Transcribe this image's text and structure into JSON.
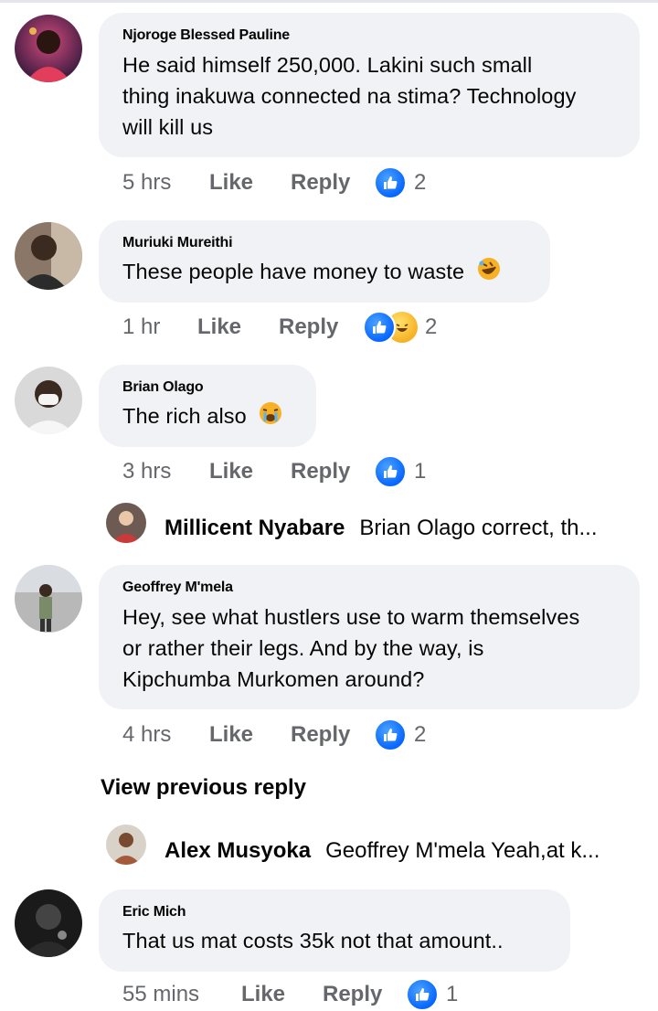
{
  "comments": [
    {
      "name": "Njoroge Blessed Pauline",
      "lines": [
        "He said himself 250,000. Lakini such small",
        "thing inakuwa connected na stima? Technology",
        "will kill us"
      ],
      "time": "5 hrs",
      "like": "Like",
      "reply": "Reply",
      "reaction_count": "2"
    },
    {
      "name": "Muriuki Mureithi",
      "lines": [
        "These people have money to waste"
      ],
      "emoji": "rolling-laughing-emoji",
      "time": "1 hr",
      "like": "Like",
      "reply": "Reply",
      "reaction_count": "2",
      "reactions": [
        "like-icon",
        "haha-icon"
      ]
    },
    {
      "name": "Brian Olago",
      "lines": [
        "The rich also"
      ],
      "emoji": "crying-face-emoji",
      "time": "3 hrs",
      "like": "Like",
      "reply": "Reply",
      "reaction_count": "1"
    },
    {
      "name": "Geoffrey M'mela",
      "lines": [
        "Hey, see what hustlers use to warm themselves",
        "or rather their legs. And by the way, is",
        "Kipchumba Murkomen around?"
      ],
      "time": "4 hrs",
      "like": "Like",
      "reply": "Reply",
      "reaction_count": "2"
    },
    {
      "name": "Eric Mich",
      "lines": [
        "That us mat costs 35k not that amount.."
      ],
      "time": "55 mins",
      "like": "Like",
      "reply": "Reply",
      "reaction_count": "1"
    }
  ],
  "replies": [
    {
      "name": "Millicent Nyabare",
      "text": "Brian Olago correct, th..."
    },
    {
      "name": "Alex Musyoka",
      "text": "Geoffrey M'mela Yeah,at k..."
    }
  ],
  "view_previous_reply": "View previous reply",
  "colors": {
    "bubble": "#f0f2f5",
    "meta": "#65676b",
    "like_blue": "#0866ff"
  }
}
